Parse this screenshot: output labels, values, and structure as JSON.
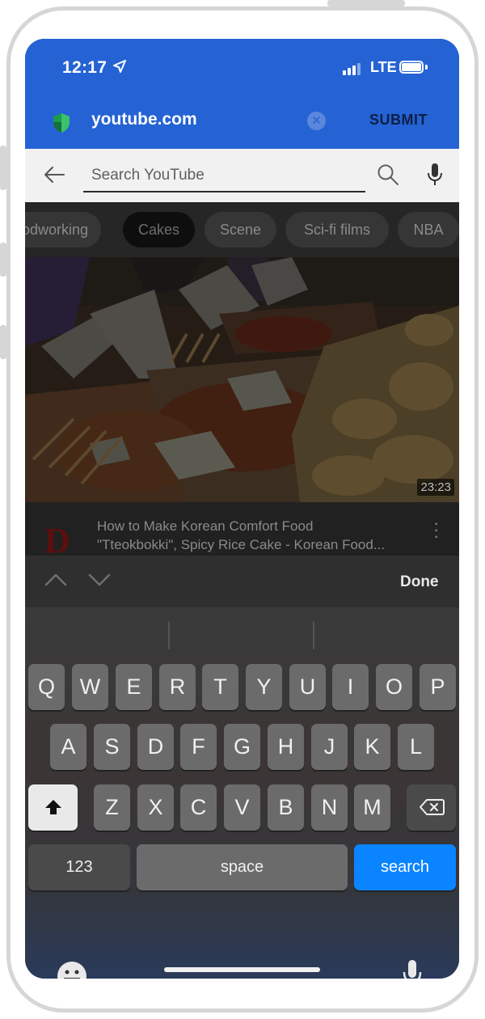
{
  "status_bar": {
    "time": "12:17",
    "network": "LTE",
    "location_icon": "location-arrow-icon",
    "signal_icon": "signal-bars-icon",
    "battery_icon": "battery-icon"
  },
  "url_bar": {
    "url": "youtube.com",
    "submit_label": "SUBMIT",
    "shield_icon": "shield-icon",
    "clear_icon": "clear-x-icon",
    "color": "#2563d4"
  },
  "search": {
    "placeholder": "Search YouTube",
    "value": "",
    "back_icon": "back-arrow-icon",
    "search_icon": "search-icon",
    "mic_icon": "mic-icon"
  },
  "chips": [
    "odworking",
    "Cakes",
    "Scene",
    "Sci-fi films",
    "NBA"
  ],
  "active_chip": "Cakes",
  "video": {
    "duration": "23:23",
    "channel_initial": "D",
    "title_line1": "How to Make Korean Comfort Food",
    "title_line2": "\"Tteokbokki\", Spicy Rice Cake - Korean Food..."
  },
  "keyboard": {
    "toolbar": {
      "done_label": "Done",
      "prev_icon": "chevron-up-icon",
      "next_icon": "chevron-down-icon"
    },
    "row1": [
      "Q",
      "W",
      "E",
      "R",
      "T",
      "Y",
      "U",
      "I",
      "O",
      "P"
    ],
    "row2": [
      "A",
      "S",
      "D",
      "F",
      "G",
      "H",
      "J",
      "K",
      "L"
    ],
    "row3": [
      "Z",
      "X",
      "C",
      "V",
      "B",
      "N",
      "M"
    ],
    "numbers_label": "123",
    "space_label": "space",
    "search_label": "search",
    "shift_icon": "shift-icon",
    "backspace_icon": "backspace-icon",
    "emoji_icon": "emoji-icon",
    "dictation_icon": "mic-icon",
    "accent": "#0a84ff"
  }
}
